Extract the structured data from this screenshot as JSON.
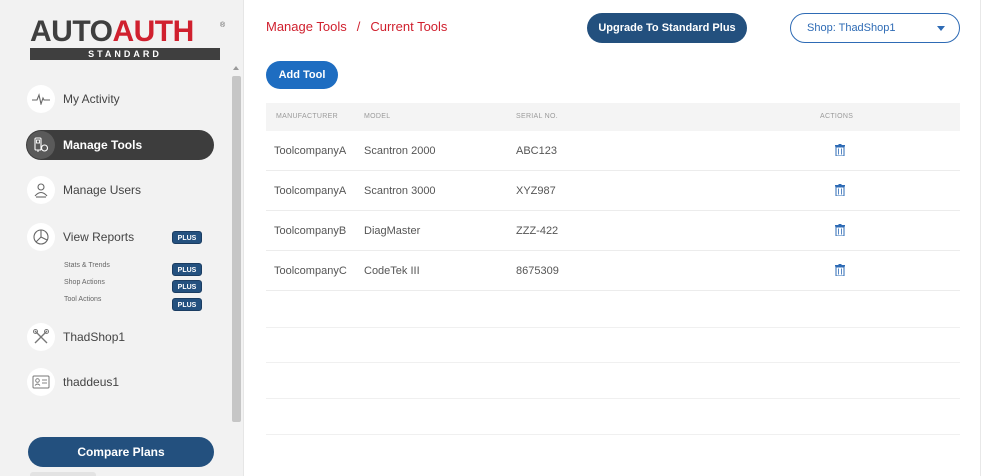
{
  "brand": {
    "logo_auto": "AUTO",
    "logo_auth": "AUTH",
    "logo_reg": "®",
    "logo_sub": "STANDARD",
    "colors": {
      "brand_red": "#d0202e",
      "navy": "#23507e",
      "accent_blue": "#1e6dc1"
    }
  },
  "sidebar": {
    "items": [
      {
        "label": "My Activity",
        "icon": "activity-pulse-icon"
      },
      {
        "label": "Manage Tools",
        "icon": "tools-icon",
        "active": true
      },
      {
        "label": "Manage Users",
        "icon": "users-icon"
      },
      {
        "label": "View Reports",
        "icon": "pie-chart-icon",
        "badge": "PLUS"
      },
      {
        "label": "ThadShop1",
        "icon": "wrench-screwdriver-icon"
      },
      {
        "label": "thaddeus1",
        "icon": "id-card-icon"
      }
    ],
    "subitems": [
      {
        "label": "Stats & Trends",
        "badge": "PLUS"
      },
      {
        "label": "Shop Actions",
        "badge": "PLUS"
      },
      {
        "label": "Tool Actions",
        "badge": "PLUS"
      }
    ],
    "compare_label": "Compare Plans"
  },
  "header": {
    "breadcrumb_root": "Manage Tools",
    "breadcrumb_sep": "/",
    "breadcrumb_current": "Current Tools",
    "upgrade_label": "Upgrade To Standard Plus",
    "shop_select_value": "Shop: ThadShop1"
  },
  "main": {
    "add_tool_label": "Add Tool",
    "table": {
      "columns": [
        "MANUFACTURER",
        "MODEL",
        "SERIAL NO.",
        "ACTIONS"
      ],
      "rows": [
        {
          "manufacturer": "ToolcompanyA",
          "model": "Scantron 2000",
          "serial": "ABC123",
          "action_icon": "trash-icon"
        },
        {
          "manufacturer": "ToolcompanyA",
          "model": "Scantron 3000",
          "serial": "XYZ987",
          "action_icon": "trash-icon"
        },
        {
          "manufacturer": "ToolcompanyB",
          "model": "DiagMaster",
          "serial": "ZZZ-422",
          "action_icon": "trash-icon"
        },
        {
          "manufacturer": "ToolcompanyC",
          "model": "CodeTek III",
          "serial": "8675309",
          "action_icon": "trash-icon"
        }
      ]
    }
  }
}
